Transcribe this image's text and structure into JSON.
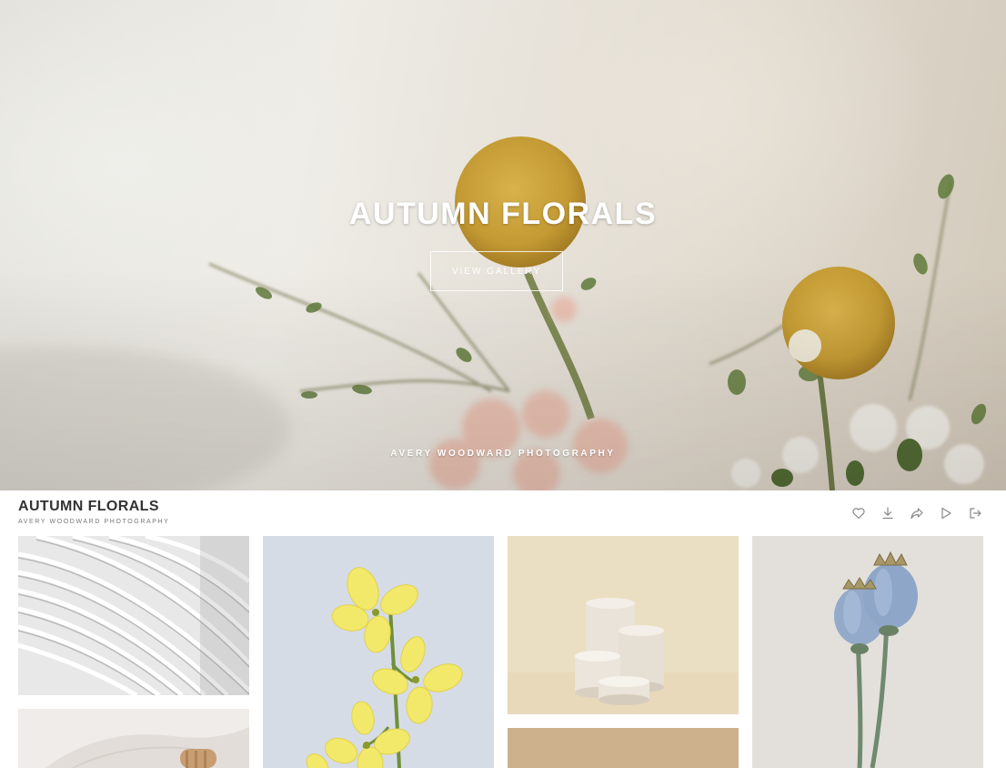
{
  "hero": {
    "title": "AUTUMN FLORALS",
    "button_label": "VIEW GALLERY",
    "subtitle": "AVERY WOODWARD PHOTOGRAPHY"
  },
  "header": {
    "title": "AUTUMN FLORALS",
    "subtitle": "AVERY WOODWARD PHOTOGRAPHY",
    "actions": [
      {
        "name": "favorite",
        "icon": "heart-icon"
      },
      {
        "name": "download",
        "icon": "download-icon"
      },
      {
        "name": "share",
        "icon": "share-icon"
      },
      {
        "name": "slideshow",
        "icon": "play-icon"
      },
      {
        "name": "exit",
        "icon": "exit-icon"
      }
    ]
  },
  "gallery": {
    "photos": [
      {
        "subject": "white-architecture"
      },
      {
        "subject": "yellow-flowers"
      },
      {
        "subject": "cylinder-pedestals"
      },
      {
        "subject": "blue-poppy-pods"
      },
      {
        "subject": "linen-and-wood"
      },
      {
        "subject": "tan-backdrop"
      }
    ]
  },
  "colors": {
    "text": "#333333",
    "muted": "#777777",
    "icon": "#888888",
    "accent_yellow": "#c9a23a"
  }
}
